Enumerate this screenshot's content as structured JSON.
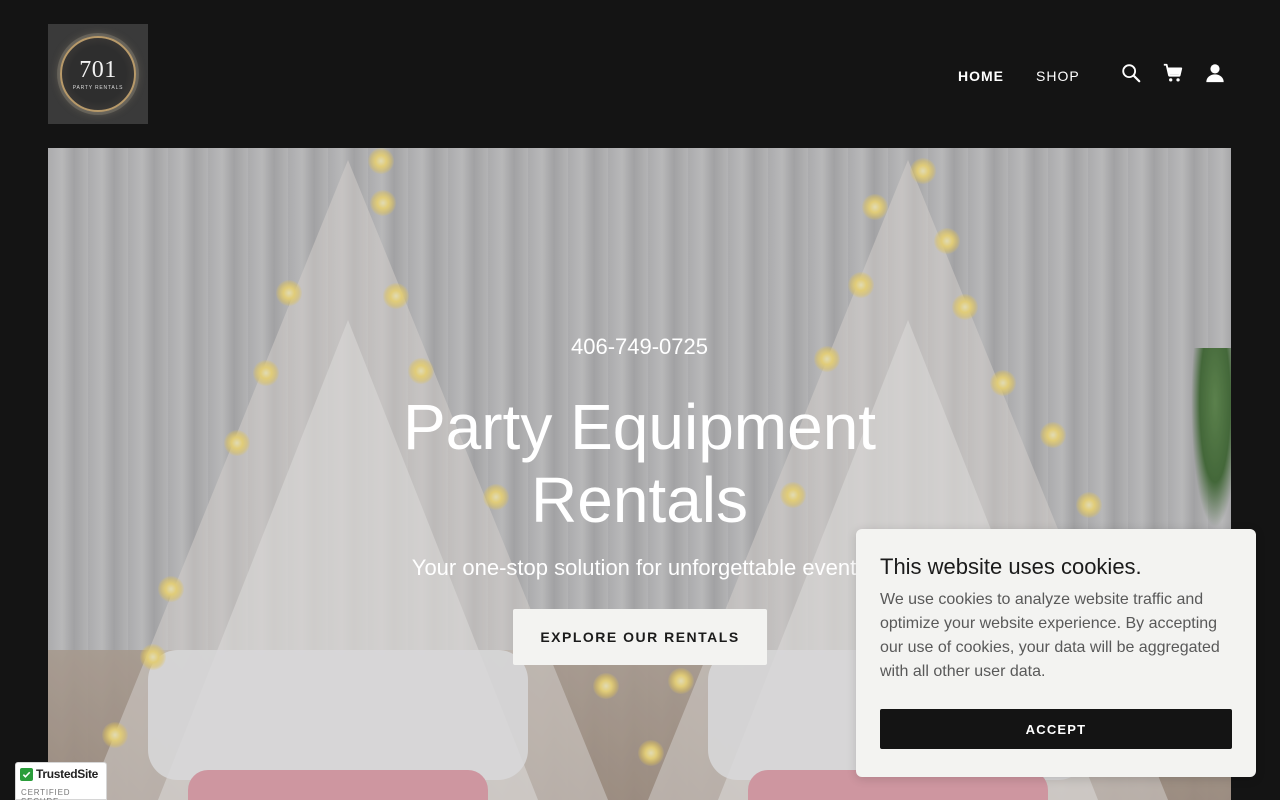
{
  "header": {
    "logo": {
      "number": "701",
      "subtext": "PARTY RENTALS"
    },
    "nav": [
      {
        "label": "HOME",
        "active": true
      },
      {
        "label": "SHOP",
        "active": false
      }
    ],
    "icons": [
      "search-icon",
      "cart-icon",
      "account-icon"
    ]
  },
  "hero": {
    "phone": "406-749-0725",
    "title_line1": "Party Equipment",
    "title_line2": "Rentals",
    "subtitle": "Your one-stop solution for unforgettable events",
    "cta_label": "EXPLORE OUR RENTALS"
  },
  "cookie_banner": {
    "title": "This website uses cookies.",
    "text": "We use cookies to analyze website traffic and optimize your website experience. By accepting our use of cookies, your data will be aggregated with all other user data.",
    "accept_label": "ACCEPT"
  },
  "trust_badge": {
    "name": "TrustedSite",
    "sub": "CERTIFIED SECURE"
  },
  "colors": {
    "header_bg": "#141414",
    "button_light": "#f3f3f1",
    "button_dark": "#141414",
    "trust_green": "#2a9d3a"
  }
}
